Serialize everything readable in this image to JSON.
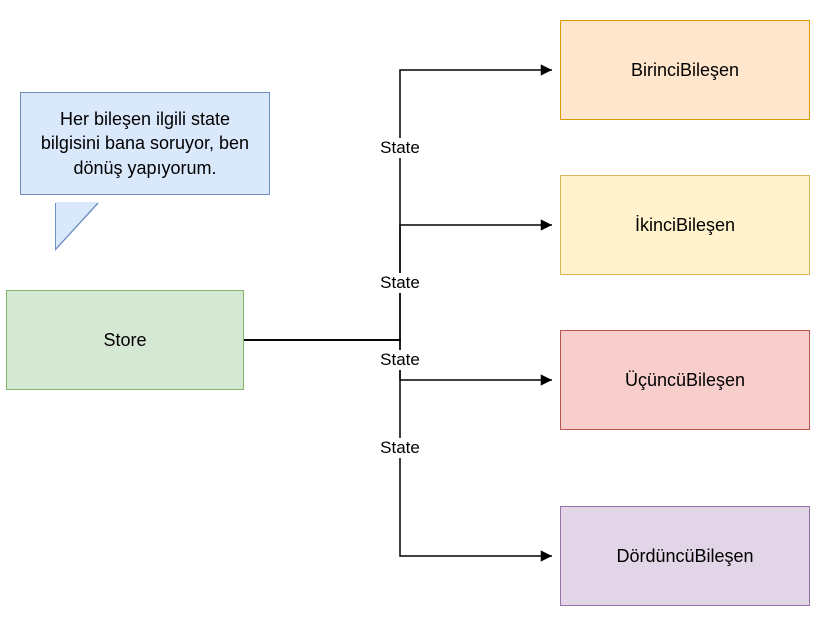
{
  "store": {
    "label": "Store",
    "bg": "#d5e8d4",
    "border": "#82b366"
  },
  "callout": {
    "text": "Her bileşen ilgili state bilgisini bana soruyor, ben dönüş yapıyorum."
  },
  "components": [
    {
      "label": "BirinciBileşen",
      "bg": "#ffe6cc",
      "border": "#d79b00"
    },
    {
      "label": "İkinciBileşen",
      "bg": "#fff2cc",
      "border": "#d6b656"
    },
    {
      "label": "ÜçüncüBileşen",
      "bg": "#f8cecc",
      "border": "#b85450"
    },
    {
      "label": "DördüncüBileşen",
      "bg": "#e1d5e7",
      "border": "#9673a6"
    }
  ],
  "edge_label": "State"
}
